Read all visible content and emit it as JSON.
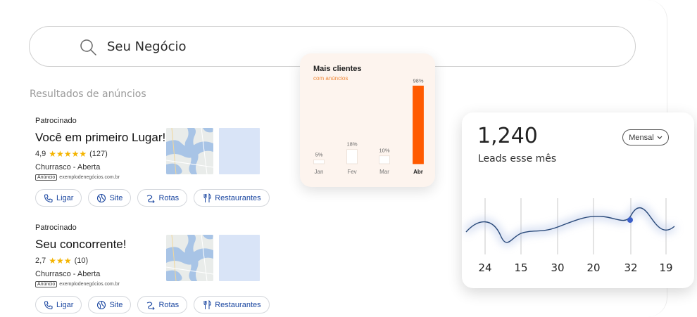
{
  "search": {
    "value": "Seu Negócio",
    "icon": "search-icon"
  },
  "results_title": "Resultados de anúncios",
  "ads": [
    {
      "sponsor": "Patrocinado",
      "name": "Você em primeiro Lugar!",
      "rating_value": "4,9",
      "stars": "★★★★★",
      "review_count": "(127)",
      "status": "Churrasco - Aberta",
      "badge": "Anúncio",
      "url": "exemplodenegócios.com.br",
      "actions": [
        "Ligar",
        "Site",
        "Rotas",
        "Restaurantes"
      ]
    },
    {
      "sponsor": "Patrocinado",
      "name": "Seu concorrente!",
      "rating_value": "2,7",
      "stars": "★★★",
      "review_count": "(10)",
      "status": "Churrasco - Aberta",
      "badge": "Anúncio",
      "url": "exemplodenegócios.com.br",
      "actions": [
        "Ligar",
        "Site",
        "Rotas",
        "Restaurantes"
      ]
    }
  ],
  "bar_card": {
    "title": "Mais clientes",
    "subtitle": "com anúncios"
  },
  "leads_card": {
    "value": "1,240",
    "label": "Leads esse mês",
    "period": "Mensal"
  },
  "colors": {
    "accent": "#ff5a00",
    "link_blue": "#1a46a0",
    "line": "#2a4a7a",
    "point": "#3b5fc9"
  },
  "chart_data": [
    {
      "type": "bar",
      "title": "Mais clientes",
      "subtitle": "com anúncios",
      "categories": [
        "Jan",
        "Fev",
        "Mar",
        "Abr"
      ],
      "values": [
        5,
        18,
        10,
        98
      ],
      "value_labels": [
        "5%",
        "18%",
        "10%",
        "98%"
      ],
      "highlight": "Abr",
      "ylim": [
        0,
        100
      ]
    },
    {
      "type": "line",
      "title": "",
      "x_labels": [
        "24",
        "15",
        "30",
        "20",
        "32",
        "19"
      ],
      "highlight_point": "32",
      "grid": "vertical"
    }
  ]
}
